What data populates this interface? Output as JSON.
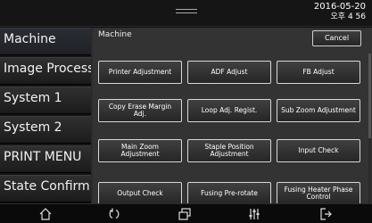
{
  "status": {
    "date": "2016-05-20",
    "time": "오후 4 56"
  },
  "sidebar": {
    "items": [
      {
        "label": "Machine"
      },
      {
        "label": "Image Process"
      },
      {
        "label": "System 1"
      },
      {
        "label": "System 2"
      },
      {
        "label": "PRINT MENU"
      },
      {
        "label": "State Confirm"
      }
    ]
  },
  "panel": {
    "title": "Machine",
    "cancel_label": "Cancel",
    "buttons": [
      {
        "label": "Printer Adjustment"
      },
      {
        "label": "ADF Adjust"
      },
      {
        "label": "FB Adjust"
      },
      {
        "label": "Copy Erase Margin Adj."
      },
      {
        "label": "Loop Adj. Regist."
      },
      {
        "label": "Sub Zoom Adjustment"
      },
      {
        "label": "Main Zoom Adjustment"
      },
      {
        "label": "Staple Position Adjustment"
      },
      {
        "label": "Input Check"
      },
      {
        "label": "Output Check"
      },
      {
        "label": "Fusing Pre-rotate"
      },
      {
        "label": "Fusing Heater Phase Control"
      }
    ]
  },
  "bottombar": {
    "icons": [
      "home-icon",
      "refresh-icon",
      "copy-windows-icon",
      "sliders-icon",
      "logout-icon"
    ]
  }
}
